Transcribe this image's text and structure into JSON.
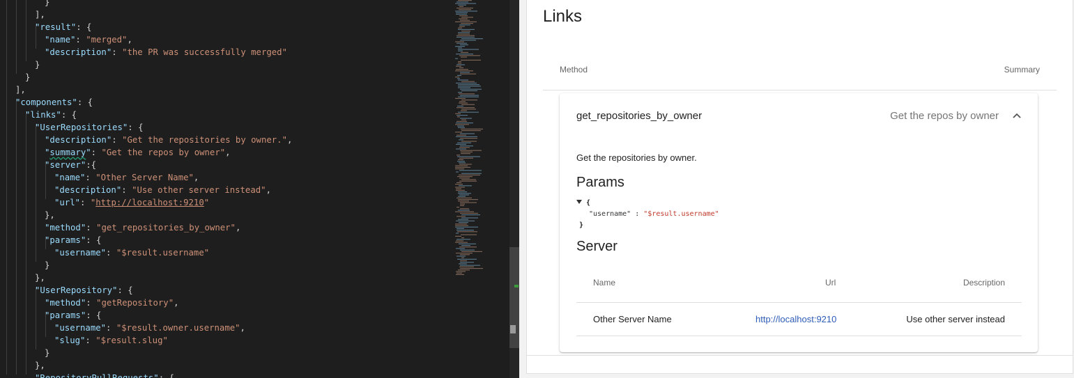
{
  "editor": {
    "lines": [
      [
        {
          "t": "}",
          "c": "p"
        }
      ],
      [
        {
          "t": "],",
          "c": "p"
        }
      ],
      [
        {
          "t": "\"result\"",
          "c": "k"
        },
        {
          "t": ": {",
          "c": "p"
        }
      ],
      [
        {
          "t": "\"name\"",
          "c": "k"
        },
        {
          "t": ": ",
          "c": "p"
        },
        {
          "t": "\"merged\"",
          "c": "s"
        },
        {
          "t": ",",
          "c": "p"
        }
      ],
      [
        {
          "t": "\"description\"",
          "c": "k"
        },
        {
          "t": ": ",
          "c": "p"
        },
        {
          "t": "\"the PR was successfully merged\"",
          "c": "s"
        }
      ],
      [
        {
          "t": "}",
          "c": "p"
        }
      ],
      [
        {
          "t": "}",
          "c": "p"
        }
      ],
      [
        {
          "t": "],",
          "c": "p"
        }
      ],
      [
        {
          "t": "\"components\"",
          "c": "k"
        },
        {
          "t": ": {",
          "c": "p"
        }
      ],
      [
        {
          "t": "\"links\"",
          "c": "k"
        },
        {
          "t": ": {",
          "c": "p"
        }
      ],
      [
        {
          "t": "\"UserRepositories\"",
          "c": "k"
        },
        {
          "t": ": {",
          "c": "p"
        }
      ],
      [
        {
          "t": "\"description\"",
          "c": "k"
        },
        {
          "t": ": ",
          "c": "p"
        },
        {
          "t": "\"Get the repositories by owner.\"",
          "c": "s"
        },
        {
          "t": ",",
          "c": "p"
        }
      ],
      [
        {
          "t": "\"",
          "c": "k"
        },
        {
          "t": "summary",
          "c": "k squiggle"
        },
        {
          "t": "\"",
          "c": "k"
        },
        {
          "t": ": ",
          "c": "p"
        },
        {
          "t": "\"Get the repos by owner\"",
          "c": "s"
        },
        {
          "t": ",",
          "c": "p"
        }
      ],
      [
        {
          "t": "\"server\"",
          "c": "k"
        },
        {
          "t": ":{",
          "c": "p"
        }
      ],
      [
        {
          "t": "\"name\"",
          "c": "k"
        },
        {
          "t": ": ",
          "c": "p"
        },
        {
          "t": "\"Other Server Name\"",
          "c": "s"
        },
        {
          "t": ",",
          "c": "p"
        }
      ],
      [
        {
          "t": "\"description\"",
          "c": "k"
        },
        {
          "t": ": ",
          "c": "p"
        },
        {
          "t": "\"Use other server instead\"",
          "c": "s"
        },
        {
          "t": ",",
          "c": "p"
        }
      ],
      [
        {
          "t": "\"url\"",
          "c": "k"
        },
        {
          "t": ": ",
          "c": "p"
        },
        {
          "t": "\"",
          "c": "s"
        },
        {
          "t": "http://localhost:9210",
          "c": "u"
        },
        {
          "t": "\"",
          "c": "s"
        }
      ],
      [
        {
          "t": "},",
          "c": "p"
        }
      ],
      [
        {
          "t": "\"method\"",
          "c": "k"
        },
        {
          "t": ": ",
          "c": "p"
        },
        {
          "t": "\"get_repositories_by_owner\"",
          "c": "s"
        },
        {
          "t": ",",
          "c": "p"
        }
      ],
      [
        {
          "t": "\"params\"",
          "c": "k"
        },
        {
          "t": ": {",
          "c": "p"
        }
      ],
      [
        {
          "t": "\"username\"",
          "c": "k"
        },
        {
          "t": ": ",
          "c": "p"
        },
        {
          "t": "\"$result.username\"",
          "c": "s"
        }
      ],
      [
        {
          "t": "}",
          "c": "p"
        }
      ],
      [
        {
          "t": "},",
          "c": "p"
        }
      ],
      [
        {
          "t": "\"UserRepository\"",
          "c": "k"
        },
        {
          "t": ": {",
          "c": "p"
        }
      ],
      [
        {
          "t": "\"method\"",
          "c": "k"
        },
        {
          "t": ": ",
          "c": "p"
        },
        {
          "t": "\"getRepository\"",
          "c": "s"
        },
        {
          "t": ",",
          "c": "p"
        }
      ],
      [
        {
          "t": "\"params\"",
          "c": "k"
        },
        {
          "t": ": {",
          "c": "p"
        }
      ],
      [
        {
          "t": "\"username\"",
          "c": "k"
        },
        {
          "t": ": ",
          "c": "p"
        },
        {
          "t": "\"$result.owner.username\"",
          "c": "s"
        },
        {
          "t": ",",
          "c": "p"
        }
      ],
      [
        {
          "t": "\"slug\"",
          "c": "k"
        },
        {
          "t": ": ",
          "c": "p"
        },
        {
          "t": "\"$result.slug\"",
          "c": "s"
        }
      ],
      [
        {
          "t": "}",
          "c": "p"
        }
      ],
      [
        {
          "t": "},",
          "c": "p"
        }
      ],
      [
        {
          "t": "\"RepositoryPullRequests\"",
          "c": "k"
        },
        {
          "t": ": {",
          "c": "p"
        }
      ]
    ],
    "indents": [
      4,
      3,
      3,
      4,
      4,
      3,
      2,
      1,
      1,
      2,
      3,
      4,
      4,
      4,
      5,
      5,
      5,
      4,
      4,
      4,
      5,
      4,
      3,
      3,
      4,
      4,
      5,
      5,
      4,
      3,
      3
    ]
  },
  "docs": {
    "title": "Links",
    "table_headers": {
      "method": "Method",
      "summary": "Summary"
    },
    "link": {
      "method": "get_repositories_by_owner",
      "summary": "Get the repos by owner",
      "description": "Get the repositories by owner.",
      "params_title": "Params",
      "params_open": "{",
      "params_key": "\"username\"",
      "params_sep": " : ",
      "params_value": "\"$result.username\"",
      "params_close": "}",
      "server_title": "Server",
      "server_headers": {
        "name": "Name",
        "url": "Url",
        "description": "Description"
      },
      "server": {
        "name": "Other Server Name",
        "url": "http://localhost:9210",
        "description": "Use other server instead"
      }
    }
  },
  "colors": {
    "editor_bg": "#1e1e1e",
    "json_key": "#9cdcfe",
    "json_string": "#ce9178",
    "link": "#2e5cb8"
  }
}
